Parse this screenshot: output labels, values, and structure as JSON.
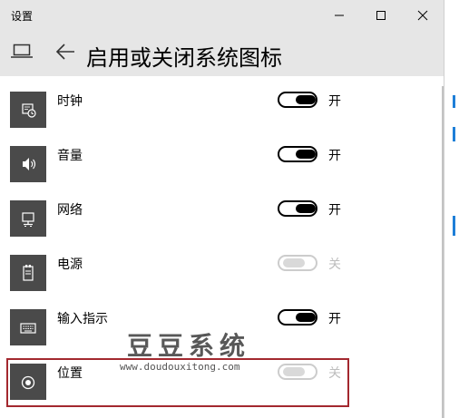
{
  "window": {
    "title": "设置"
  },
  "header": {
    "page_title": "启用或关闭系统图标"
  },
  "items": [
    {
      "label": "时钟",
      "state": "开",
      "on": true,
      "disabled": false,
      "icon": "clock-icon"
    },
    {
      "label": "音量",
      "state": "开",
      "on": true,
      "disabled": false,
      "icon": "volume-icon"
    },
    {
      "label": "网络",
      "state": "开",
      "on": true,
      "disabled": false,
      "icon": "network-icon"
    },
    {
      "label": "电源",
      "state": "关",
      "on": false,
      "disabled": true,
      "icon": "power-icon"
    },
    {
      "label": "输入指示",
      "state": "开",
      "on": true,
      "disabled": false,
      "icon": "keyboard-icon"
    },
    {
      "label": "位置",
      "state": "关",
      "on": false,
      "disabled": true,
      "icon": "location-icon"
    }
  ],
  "watermark": {
    "title": "豆豆系统",
    "url": "www.doudouxitong.com"
  },
  "colors": {
    "titlebar_bg": "#e6e6e6",
    "tile_bg": "#4a4a4a",
    "highlight_border": "#a3282f",
    "scrollbar": "#c3c3c3"
  }
}
